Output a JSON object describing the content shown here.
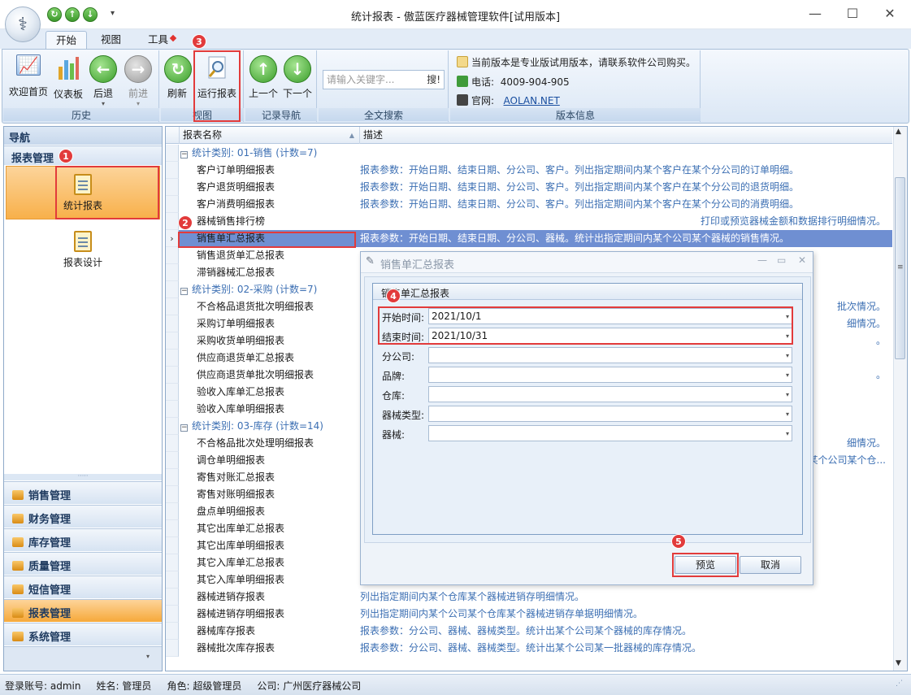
{
  "window": {
    "title": "统计报表 - 傲蓝医疗器械管理软件[试用版本]"
  },
  "ribbon_tabs": [
    "开始",
    "视图",
    "工具"
  ],
  "ribbon": {
    "history": {
      "label": "历史",
      "buttons": [
        "欢迎首页",
        "仪表板",
        "后退",
        "前进"
      ]
    },
    "view": {
      "label": "视图",
      "buttons": [
        "刷新",
        "运行报表"
      ]
    },
    "record_nav": {
      "label": "记录导航",
      "buttons": [
        "上一个",
        "下一个"
      ]
    },
    "fulltext": {
      "label": "全文搜索",
      "placeholder": "请输入关键字...",
      "search_btn": "搜!"
    },
    "version": {
      "label": "版本信息",
      "notice": "当前版本是专业版试用版本，请联系软件公司购买。",
      "phone_label": "电话:",
      "phone": "4009-904-905",
      "site_label": "官网:",
      "site": "AOLAN.NET"
    }
  },
  "nav": {
    "header": "导航",
    "section": "报表管理",
    "items": [
      "统计报表",
      "报表设计"
    ],
    "categories": [
      "销售管理",
      "财务管理",
      "库存管理",
      "质量管理",
      "短信管理",
      "报表管理",
      "系统管理"
    ]
  },
  "grid": {
    "columns": [
      "报表名称",
      "描述"
    ],
    "rows": [
      {
        "group": "统计类别: 01-销售 (计数=7)"
      },
      {
        "name": "客户订单明细报表",
        "desc": "报表参数：开始日期、结束日期、分公司、客户。列出指定期间内某个客户在某个分公司的订单明细。"
      },
      {
        "name": "客户退货明细报表",
        "desc": "报表参数：开始日期、结束日期、分公司、客户。列出指定期间内某个客户在某个分公司的退货明细。"
      },
      {
        "name": "客户消费明细报表",
        "desc": "报表参数：开始日期、结束日期、分公司、客户。列出指定期间内某个客户在某个分公司的消费明细。"
      },
      {
        "name": "器械销售排行榜",
        "desc": "打印或预览器械金额和数据排行明细情况。"
      },
      {
        "name": "销售单汇总报表",
        "desc": "报表参数：开始日期、结束日期、分公司、器械。统计出指定期间内某个公司某个器械的销售情况。",
        "selected": true
      },
      {
        "name": "销售退货单汇总报表",
        "desc": ""
      },
      {
        "name": "滞销器械汇总报表",
        "desc": ""
      },
      {
        "group": "统计类别: 02-采购 (计数=7)"
      },
      {
        "name": "不合格品退货批次明细报表",
        "desc": "批次情况。"
      },
      {
        "name": "采购订单明细报表",
        "desc": "细情况。"
      },
      {
        "name": "采购收货单明细报表",
        "desc": "。"
      },
      {
        "name": "供应商退货单汇总报表",
        "desc": ""
      },
      {
        "name": "供应商退货单批次明细报表",
        "desc": "。"
      },
      {
        "name": "验收入库单汇总报表",
        "desc": ""
      },
      {
        "name": "验收入库单明细报表",
        "desc": ""
      },
      {
        "group": "统计类别: 03-库存 (计数=14)"
      },
      {
        "name": "不合格品批次处理明细报表",
        "desc": "细情况。"
      },
      {
        "name": "调仓单明细报表",
        "desc": "某个公司某个仓..."
      },
      {
        "name": "寄售对账汇总报表",
        "desc": ""
      },
      {
        "name": "寄售对账明细报表",
        "desc": ""
      },
      {
        "name": "盘点单明细报表",
        "desc": ""
      },
      {
        "name": "其它出库单汇总报表",
        "desc": ""
      },
      {
        "name": "其它出库单明细报表",
        "desc": ""
      },
      {
        "name": "其它入库单汇总报表",
        "desc": ""
      },
      {
        "name": "其它入库单明细报表",
        "desc": ""
      },
      {
        "name": "器械进销存报表",
        "desc": "列出指定期间内某个仓库某个器械进销存明细情况。"
      },
      {
        "name": "器械进销存明细报表",
        "desc": "列出指定期间内某个公司某个仓库某个器械进销存单据明细情况。"
      },
      {
        "name": "器械库存报表",
        "desc": "报表参数：分公司、器械、器械类型。统计出某个公司某个器械的库存情况。"
      },
      {
        "name": "器械批次库存报表",
        "desc": "报表参数：分公司、器械、器械类型。统计出某个公司某一批器械的库存情况。"
      }
    ]
  },
  "dialog": {
    "title": "销售单汇总报表",
    "legend": "销售单汇总报表",
    "fields": [
      {
        "label": "开始时间:",
        "value": "2021/10/1"
      },
      {
        "label": "结束时间:",
        "value": "2021/10/31"
      },
      {
        "label": "分公司:",
        "value": ""
      },
      {
        "label": "品牌:",
        "value": ""
      },
      {
        "label": "仓库:",
        "value": ""
      },
      {
        "label": "器械类型:",
        "value": ""
      },
      {
        "label": "器械:",
        "value": ""
      }
    ],
    "preview": "预览",
    "cancel": "取消"
  },
  "status": {
    "account": "登录账号: admin",
    "name": "姓名: 管理员",
    "role": "角色: 超级管理员",
    "company": "公司: 广州医疗器械公司"
  },
  "badges": [
    "1",
    "2",
    "3",
    "4",
    "5"
  ],
  "colors": {
    "annotation": "#e23b3b",
    "selected_row": "#6f8fd2",
    "nav_selected": "#f8b04a"
  }
}
